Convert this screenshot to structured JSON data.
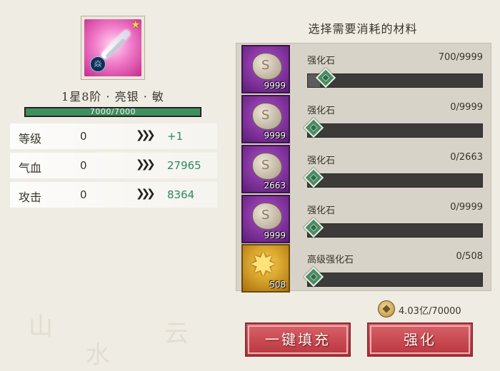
{
  "item": {
    "badge_char": "焱",
    "title": "1星8阶 · 亮银 · 敏",
    "hp_text": "7000/7000",
    "hp_fraction": 1.0
  },
  "stats": [
    {
      "label": "等级",
      "current": "0",
      "next": "+1"
    },
    {
      "label": "气血",
      "current": "0",
      "next": "27965"
    },
    {
      "label": "攻击",
      "current": "0",
      "next": "8364"
    }
  ],
  "materials_title": "选择需要消耗的材料",
  "materials": [
    {
      "name": "强化石",
      "count": "700/9999",
      "qty": "9999",
      "icon": "enhance-stone-icon",
      "fill_fraction": 0.07
    },
    {
      "name": "强化石",
      "count": "0/9999",
      "qty": "9999",
      "icon": "enhance-stone-icon",
      "fill_fraction": 0
    },
    {
      "name": "强化石",
      "count": "0/2663",
      "qty": "2663",
      "icon": "enhance-stone-icon",
      "fill_fraction": 0
    },
    {
      "name": "强化石",
      "count": "0/9999",
      "qty": "9999",
      "icon": "enhance-stone-icon",
      "fill_fraction": 0
    },
    {
      "name": "高级强化石",
      "count": "0/508",
      "qty": "508",
      "icon": "advanced-enhance-stone-icon",
      "fill_fraction": 0
    }
  ],
  "currency": {
    "text": "4.03亿/70000",
    "icon": "coin-icon"
  },
  "buttons": {
    "autofill": "一键填充",
    "enhance": "强化"
  },
  "colors": {
    "stat_up": "#2a8a58",
    "hp_bar": "#3e8f5e",
    "button": "#c8444c",
    "rare_bg": "#8a34a8",
    "epic_bg": "#e0a020"
  }
}
